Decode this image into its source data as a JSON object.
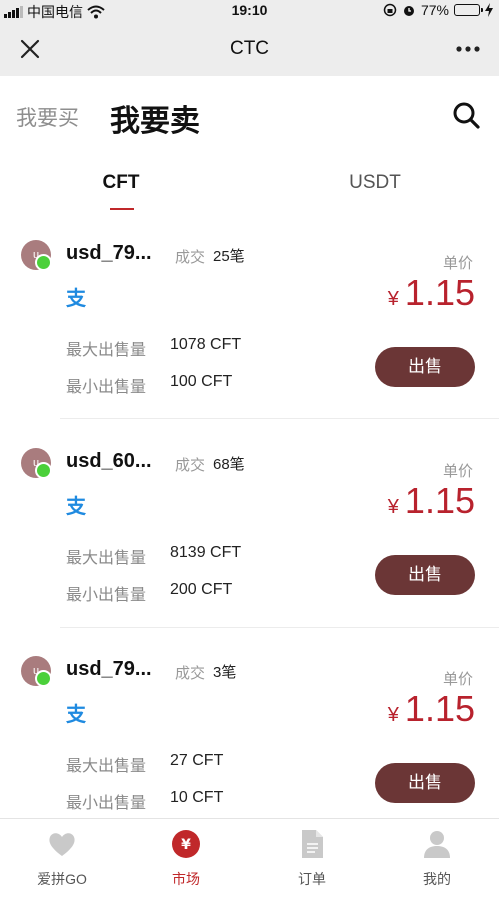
{
  "status_bar": {
    "carrier": "中国电信",
    "time": "19:10",
    "battery": "77%",
    "battery_level": 0.77,
    "icons": [
      "signal-icon",
      "wifi-icon",
      "rotation-lock-icon",
      "alarm-icon",
      "battery-icon",
      "charging-icon"
    ]
  },
  "nav": {
    "title": "CTC",
    "close_icon": "close-icon",
    "more_icon": "more-icon"
  },
  "mode": {
    "buy_label": "我要买",
    "sell_label": "我要卖",
    "search_icon": "search-icon"
  },
  "coin_tabs": [
    {
      "label": "CFT",
      "active": true
    },
    {
      "label": "USDT",
      "active": false
    }
  ],
  "listings": [
    {
      "avatar_text": "u",
      "username": "usd_79...",
      "deal_label": "成交",
      "deal_count": "25笔",
      "pay_icon": "alipay-icon",
      "price_label": "单价",
      "currency": "¥",
      "price": "1.15",
      "max_label": "最大出售量",
      "max_value": "1078 CFT",
      "min_label": "最小出售量",
      "min_value": "100 CFT",
      "button_label": "出售"
    },
    {
      "avatar_text": "u",
      "username": "usd_60...",
      "deal_label": "成交",
      "deal_count": "68笔",
      "pay_icon": "alipay-icon",
      "price_label": "单价",
      "currency": "¥",
      "price": "1.15",
      "max_label": "最大出售量",
      "max_value": "8139 CFT",
      "min_label": "最小出售量",
      "min_value": "200 CFT",
      "button_label": "出售"
    },
    {
      "avatar_text": "u",
      "username": "usd_79...",
      "deal_label": "成交",
      "deal_count": "3笔",
      "pay_icon": "alipay-icon",
      "price_label": "单价",
      "currency": "¥",
      "price": "1.15",
      "max_label": "最大出售量",
      "max_value": "27 CFT",
      "min_label": "最小出售量",
      "min_value": "10 CFT",
      "button_label": "出售"
    }
  ],
  "tabbar": [
    {
      "label": "爱拼GO",
      "icon": "heart-icon",
      "active": false
    },
    {
      "label": "市场",
      "icon": "market-yen-icon",
      "icon_text": "¥",
      "active": true
    },
    {
      "label": "订单",
      "icon": "order-document-icon",
      "active": false
    },
    {
      "label": "我的",
      "icon": "profile-icon",
      "active": false
    }
  ],
  "colors": {
    "accent_red": "#c0282a",
    "price_red": "#b8222d",
    "sell_button": "#6b3636",
    "online_green": "#4bd03a",
    "bar_bg": "#ededed"
  }
}
